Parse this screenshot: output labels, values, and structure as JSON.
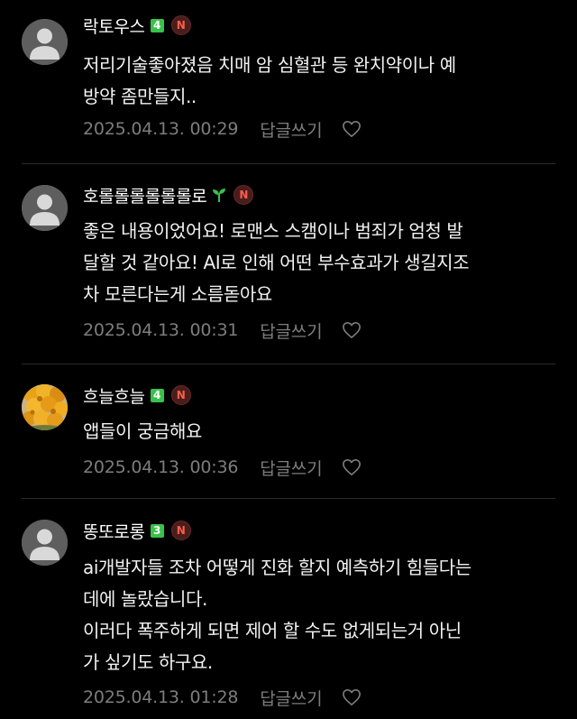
{
  "comments": [
    {
      "nickname": "락토우스",
      "level": "4",
      "has_sprout": false,
      "n_badge": "N",
      "lines": [
        "저리기술좋아졌음 치매 암 심혈관 등 완치약이나 예",
        "방약 좀만들지.."
      ],
      "date": "2025.04.13. 00:29",
      "reply_label": "답글쓰기",
      "avatar": "default"
    },
    {
      "nickname": "호롤롤롤롤롤롤로",
      "level": "",
      "has_sprout": true,
      "n_badge": "N",
      "lines": [
        "좋은 내용이었어요! 로맨스 스캠이나 범죄가 엄청 발",
        "달할 것 같아요! AI로 인해 어떤 부수효과가 생길지조",
        "차 모른다는게 소름돋아요"
      ],
      "date": "2025.04.13. 00:31",
      "reply_label": "답글쓰기",
      "avatar": "default"
    },
    {
      "nickname": "흐늘흐늘",
      "level": "4",
      "has_sprout": false,
      "n_badge": "N",
      "lines": [
        "앱들이 궁금해요"
      ],
      "date": "2025.04.13. 00:36",
      "reply_label": "답글쓰기",
      "avatar": "flowers"
    },
    {
      "nickname": "똥또로롱",
      "level": "3",
      "has_sprout": false,
      "n_badge": "N",
      "lines": [
        "ai개발자들 조차 어떻게 진화 할지 예측하기 힘들다는",
        "데에 놀랐습니다.",
        "이러다 폭주하게 되면 제어 할 수도 없게되는거 아닌",
        "가 싶기도 하구요."
      ],
      "date": "2025.04.13. 01:28",
      "reply_label": "답글쓰기",
      "avatar": "default"
    }
  ],
  "colors": {
    "background": "#000000",
    "text": "#f2f2f2",
    "meta": "#7d7d7d",
    "level_badge": "#39c14a",
    "n_badge_text": "#ff5e4a"
  }
}
